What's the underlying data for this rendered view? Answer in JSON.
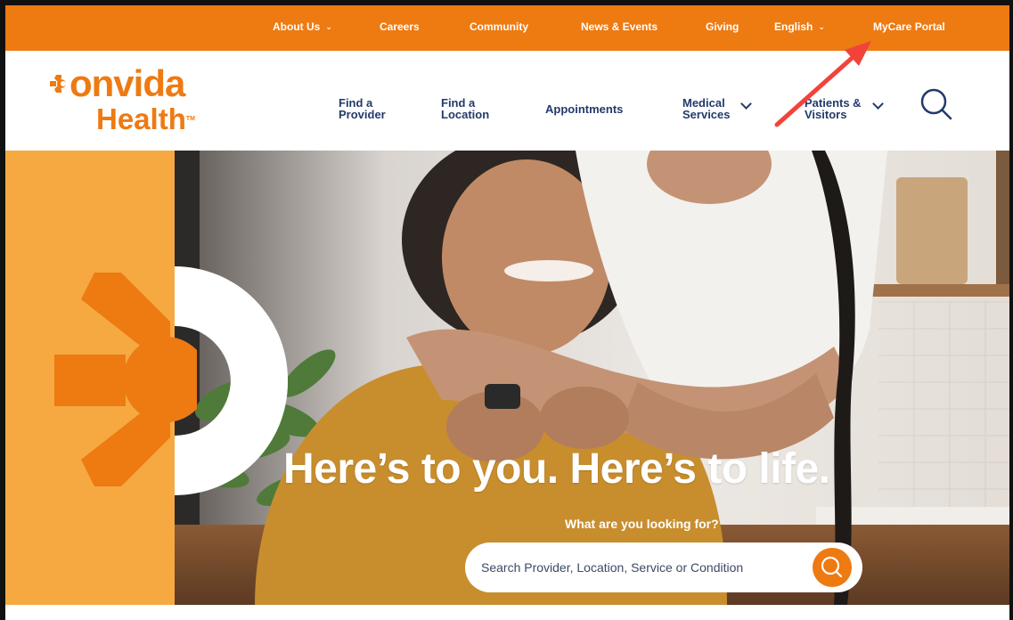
{
  "topbar": {
    "items": [
      {
        "label": "About Us",
        "has_dropdown": true
      },
      {
        "label": "Careers",
        "has_dropdown": false
      },
      {
        "label": "Community",
        "has_dropdown": false
      },
      {
        "label": "News & Events",
        "has_dropdown": false
      },
      {
        "label": "Giving",
        "has_dropdown": false
      },
      {
        "label": "English",
        "has_dropdown": true
      },
      {
        "label": "MyCare Portal",
        "has_dropdown": false
      }
    ]
  },
  "logo": {
    "line1": "onvida",
    "line2": "Health",
    "tm": "TM"
  },
  "nav": {
    "find_provider": {
      "line1": "Find a",
      "line2": "Provider"
    },
    "find_location": {
      "line1": "Find a",
      "line2": "Location"
    },
    "appointments": "Appointments",
    "medical_services": {
      "line1": "Medical",
      "line2": "Services"
    },
    "patients_visitors": {
      "line1": "Patients &",
      "line2": "Visitors"
    }
  },
  "hero": {
    "headline": "Here’s to you. Here’s to life.",
    "prompt": "What are you looking for?",
    "search_placeholder": "Search Provider, Location, Service or Condition"
  },
  "icons": {
    "search": "search-icon",
    "chevron": "chevron-down-icon",
    "logo_mark": "sun-burst-icon"
  },
  "colors": {
    "brand_orange": "#ee7a12",
    "hero_orange": "#f6a941",
    "nav_navy": "#223b6b",
    "annotation_red": "#f2433b"
  }
}
